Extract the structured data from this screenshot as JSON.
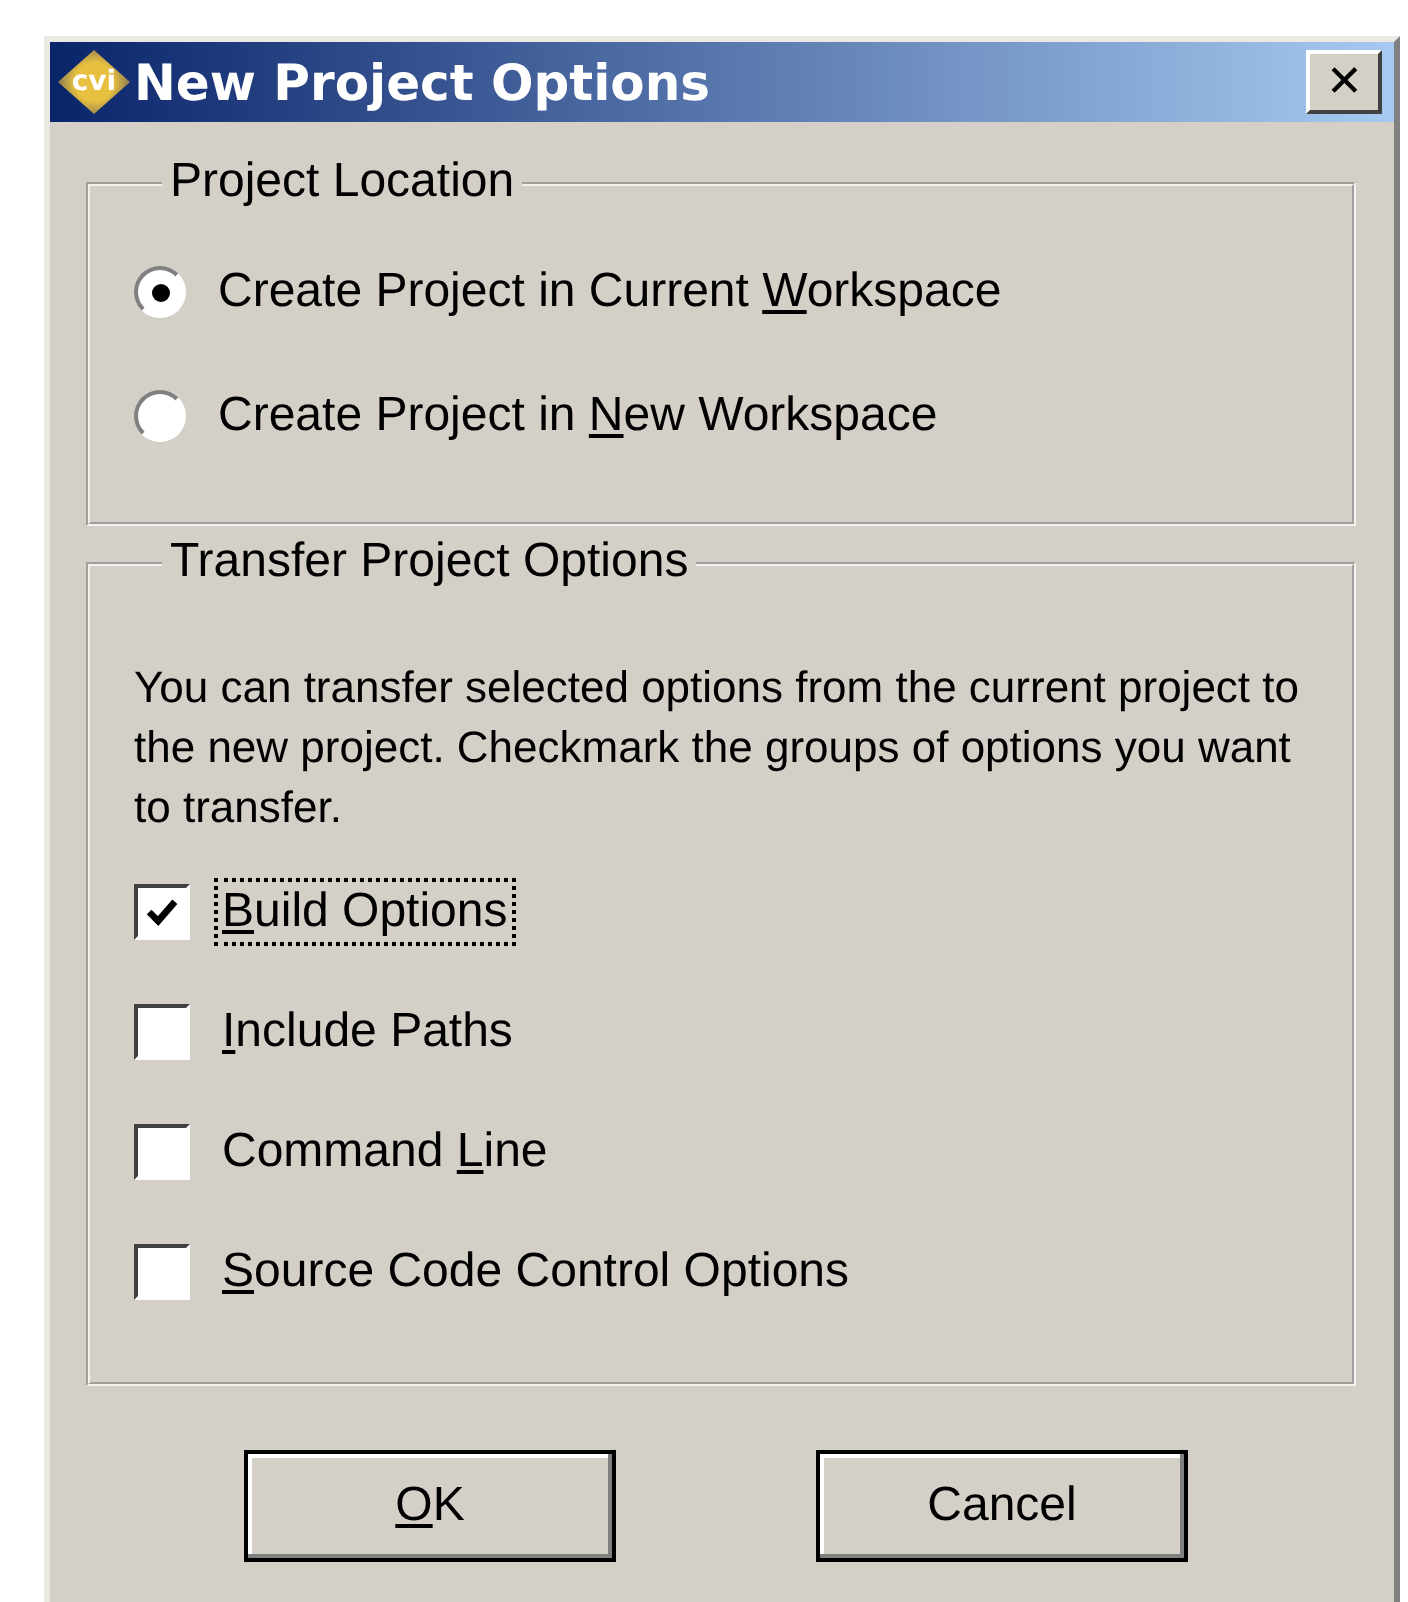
{
  "window": {
    "title": "New Project Options",
    "logo_text": "cvi",
    "close_label": "✕"
  },
  "project_location": {
    "title": "Project Location",
    "options": [
      {
        "label": {
          "pre": "Create Project in Current ",
          "key": "W",
          "post": "orkspace"
        },
        "selected": true
      },
      {
        "label": {
          "pre": "Create Project in ",
          "key": "N",
          "post": "ew Workspace"
        },
        "selected": false
      }
    ]
  },
  "transfer_options": {
    "title": "Transfer Project Options",
    "description": "You can transfer selected options from the current project to the new project.  Checkmark the groups of options you want to transfer.",
    "options": [
      {
        "label": {
          "key": "B",
          "post": "uild Options"
        },
        "checked": true,
        "focused": true
      },
      {
        "label": {
          "key": "I",
          "post": "nclude Paths"
        },
        "checked": false,
        "focused": false
      },
      {
        "label": {
          "pre": "Command ",
          "key": "L",
          "post": "ine"
        },
        "checked": false,
        "focused": false
      },
      {
        "label": {
          "key": "S",
          "post": "ource Code Control Options"
        },
        "checked": false,
        "focused": false
      }
    ]
  },
  "buttons": [
    {
      "label": {
        "key": "O",
        "post": "K"
      }
    },
    {
      "label": {
        "pre": "Cancel"
      }
    }
  ]
}
